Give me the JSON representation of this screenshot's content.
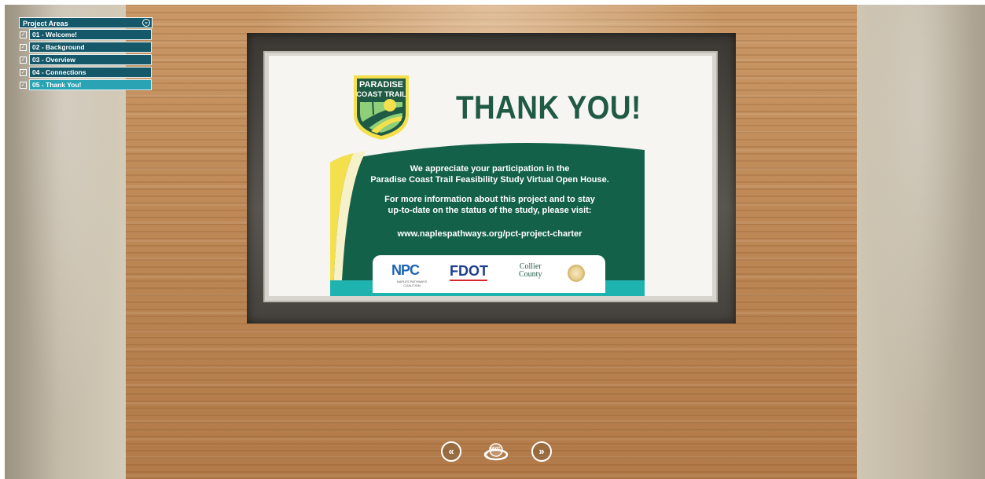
{
  "menu": {
    "title": "Project Areas",
    "items": [
      {
        "label": "01 - Welcome!",
        "active": false
      },
      {
        "label": "02 - Background",
        "active": false
      },
      {
        "label": "03 - Overview",
        "active": false
      },
      {
        "label": "04 - Connections",
        "active": false
      },
      {
        "label": "05 - Thank You!",
        "active": true
      }
    ]
  },
  "slide": {
    "logo_line1": "PARADISE",
    "logo_line2": "COAST TRAIL",
    "heading": "THANK YOU!",
    "message1_line1": "We appreciate your participation in the",
    "message1_line2": "Paradise Coast Trail Feasibility Study Virtual Open House.",
    "message2_line1": "For more information about this project and to stay",
    "message2_line2": "up-to-date on the status of the study, please visit:",
    "url": "www.naplespathways.org/pct-project-charter",
    "sponsors": {
      "npc": "NPC",
      "npc_sub": "NAPLES PATHWAYS COALITION",
      "fdot": "FDOT",
      "collier_line1": "Collier",
      "collier_line2": "County"
    }
  },
  "nav": {
    "prev_icon": "«",
    "next_icon": "»",
    "view_label": "360°"
  },
  "colors": {
    "menu_bg": "#14586a",
    "menu_active": "#2aa3b5",
    "slide_green": "#1f5a44",
    "panel_green": "#14614a",
    "accent_yellow": "#f4e04d",
    "accent_teal": "#1fb3b0"
  }
}
